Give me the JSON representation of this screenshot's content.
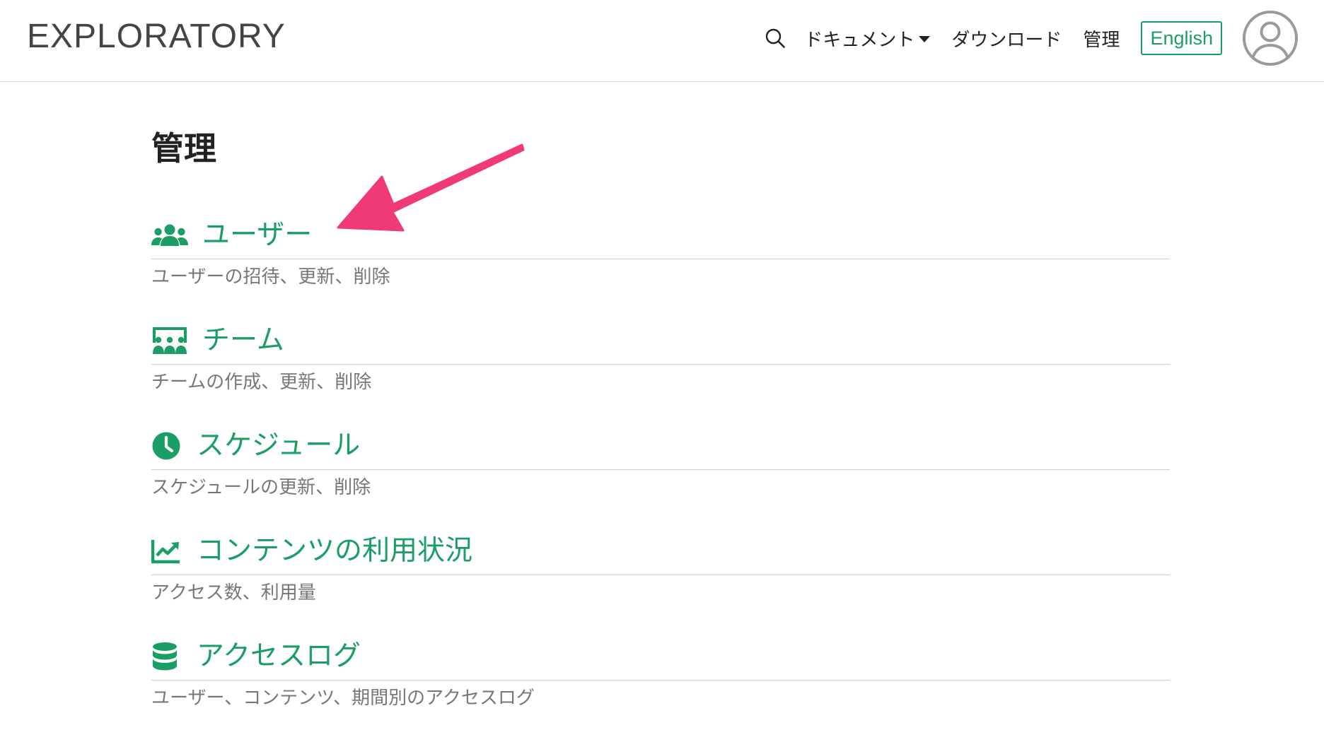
{
  "header": {
    "logo": "EXPLORATORY",
    "nav": {
      "search_icon": "search-icon",
      "documents_label": "ドキュメント",
      "download_label": "ダウンロード",
      "admin_label": "管理",
      "language_button": "English",
      "avatar_icon": "user-circle-icon"
    }
  },
  "main": {
    "title": "管理",
    "items": [
      {
        "icon": "users-icon",
        "title": "ユーザー",
        "description": "ユーザーの招待、更新、削除"
      },
      {
        "icon": "team-icon",
        "title": "チーム",
        "description": "チームの作成、更新、削除"
      },
      {
        "icon": "clock-icon",
        "title": "スケジュール",
        "description": "スケジュールの更新、削除"
      },
      {
        "icon": "line-chart-icon",
        "title": "コンテンツの利用状況",
        "description": "アクセス数、利用量"
      },
      {
        "icon": "database-icon",
        "title": "アクセスログ",
        "description": "ユーザー、コンテンツ、期間別のアクセスログ"
      }
    ]
  },
  "colors": {
    "accent": "#1a9e66",
    "annotation_arrow": "#f03a78",
    "divider": "#cfcfcf",
    "description_text": "#777777"
  }
}
